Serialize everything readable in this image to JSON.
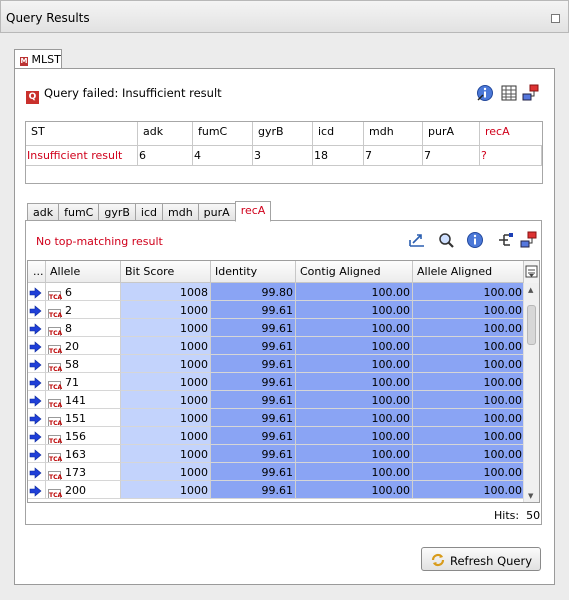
{
  "panel": {
    "title": "Query Results"
  },
  "tab": {
    "label": "MLST",
    "icon": "mlst-tab-icon"
  },
  "status": {
    "badge": "Q",
    "text": "Query failed: Insufficient result"
  },
  "summary": {
    "headers": [
      "ST",
      "adk",
      "fumC",
      "gyrB",
      "icd",
      "mdh",
      "purA",
      "recA"
    ],
    "values": [
      "Insufficient result",
      "6",
      "4",
      "3",
      "18",
      "7",
      "7",
      "?"
    ]
  },
  "locus_tabs": [
    "adk",
    "fumC",
    "gyrB",
    "icd",
    "mdh",
    "purA",
    "recA"
  ],
  "active_locus": "recA",
  "no_match": "No top-matching result",
  "results": {
    "headers": [
      "...",
      "Allele",
      "Bit Score",
      "Identity",
      "Contig Aligned",
      "Allele Aligned"
    ],
    "row_icon": "TCA",
    "rows": [
      {
        "allele": "6",
        "bit": "1008",
        "identity": "99.80",
        "contig": "100.00",
        "allele_aligned": "100.00"
      },
      {
        "allele": "2",
        "bit": "1000",
        "identity": "99.61",
        "contig": "100.00",
        "allele_aligned": "100.00"
      },
      {
        "allele": "8",
        "bit": "1000",
        "identity": "99.61",
        "contig": "100.00",
        "allele_aligned": "100.00"
      },
      {
        "allele": "20",
        "bit": "1000",
        "identity": "99.61",
        "contig": "100.00",
        "allele_aligned": "100.00"
      },
      {
        "allele": "58",
        "bit": "1000",
        "identity": "99.61",
        "contig": "100.00",
        "allele_aligned": "100.00"
      },
      {
        "allele": "71",
        "bit": "1000",
        "identity": "99.61",
        "contig": "100.00",
        "allele_aligned": "100.00"
      },
      {
        "allele": "141",
        "bit": "1000",
        "identity": "99.61",
        "contig": "100.00",
        "allele_aligned": "100.00"
      },
      {
        "allele": "151",
        "bit": "1000",
        "identity": "99.61",
        "contig": "100.00",
        "allele_aligned": "100.00"
      },
      {
        "allele": "156",
        "bit": "1000",
        "identity": "99.61",
        "contig": "100.00",
        "allele_aligned": "100.00"
      },
      {
        "allele": "163",
        "bit": "1000",
        "identity": "99.61",
        "contig": "100.00",
        "allele_aligned": "100.00"
      },
      {
        "allele": "173",
        "bit": "1000",
        "identity": "99.61",
        "contig": "100.00",
        "allele_aligned": "100.00"
      },
      {
        "allele": "200",
        "bit": "1000",
        "identity": "99.61",
        "contig": "100.00",
        "allele_aligned": "100.00"
      }
    ]
  },
  "hits": {
    "label": "Hits:",
    "value": "50"
  },
  "refresh_button": "Refresh Query",
  "colors": {
    "accent_red": "#d0001b",
    "cell_light": "#c3d3fc",
    "cell_dark": "#8aa4f4",
    "arrow_blue": "#1f3fd8"
  }
}
